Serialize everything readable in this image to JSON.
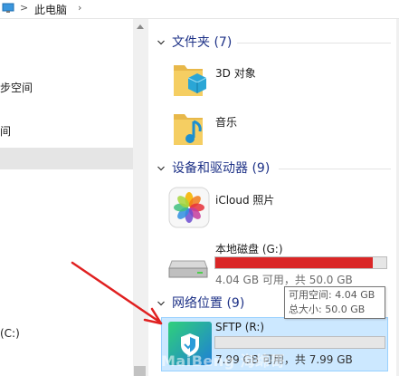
{
  "address_bar": {
    "separator": ">",
    "location": "此电脑"
  },
  "nav": {
    "items": [
      {
        "label": "步空间",
        "selected": false
      },
      {
        "label": "间",
        "selected": false
      },
      {
        "label": "",
        "selected": true
      },
      {
        "label": "(C:)",
        "selected": false
      }
    ]
  },
  "groups": {
    "folders": {
      "title": "文件夹 (7)",
      "items": [
        {
          "label": "3D 对象"
        },
        {
          "label": "音乐"
        }
      ]
    },
    "devices": {
      "title": "设备和驱动器 (9)",
      "icloud": {
        "label": "iCloud 照片"
      },
      "local_disk": {
        "label": "本地磁盘 (G:)",
        "usage": "4.04 GB 可用，共 50.0 GB",
        "fill_fraction": 0.92,
        "fill_color": "#da2626"
      }
    },
    "network": {
      "title": "网络位置 (9)",
      "sftp": {
        "label": "SFTP (R:)",
        "usage": "7.99 GB 可用，共 7.99 GB",
        "fill_fraction": 0.0
      }
    }
  },
  "tooltip": {
    "line1": "可用空间: 4.04 GB",
    "line2": "总大小: 50.0 GB"
  },
  "watermark": "MaiBeng 海绵哥",
  "colors": {
    "header": "#1e3287",
    "selection": "#cce8ff",
    "arrow": "#e02020"
  }
}
